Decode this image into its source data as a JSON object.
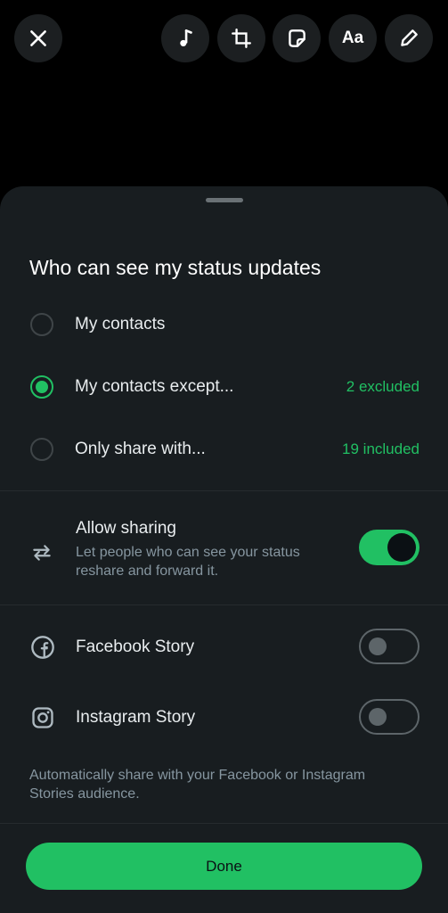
{
  "toolbar": {
    "close_icon": "close-icon",
    "music_icon": "music-note-icon",
    "crop_icon": "crop-rotate-icon",
    "sticker_icon": "sticker-icon",
    "text_label": "Aa",
    "pen_icon": "pencil-icon"
  },
  "sheet": {
    "title": "Who can see my status updates",
    "options": [
      {
        "label": "My contacts",
        "meta": "",
        "selected": false
      },
      {
        "label": "My contacts except...",
        "meta": "2 excluded",
        "selected": true
      },
      {
        "label": "Only share with...",
        "meta": "19 included",
        "selected": false
      }
    ],
    "allow_sharing": {
      "title": "Allow sharing",
      "description": "Let people who can see your status reshare and forward it.",
      "enabled": true
    },
    "facebook": {
      "label": "Facebook Story",
      "enabled": false
    },
    "instagram": {
      "label": "Instagram Story",
      "enabled": false
    },
    "auto_note": "Automatically share with your Facebook or Instagram Stories audience.",
    "done_label": "Done"
  },
  "colors": {
    "accent": "#21c063",
    "sheet_bg": "#181d20",
    "secondary_text": "#8696a0"
  }
}
